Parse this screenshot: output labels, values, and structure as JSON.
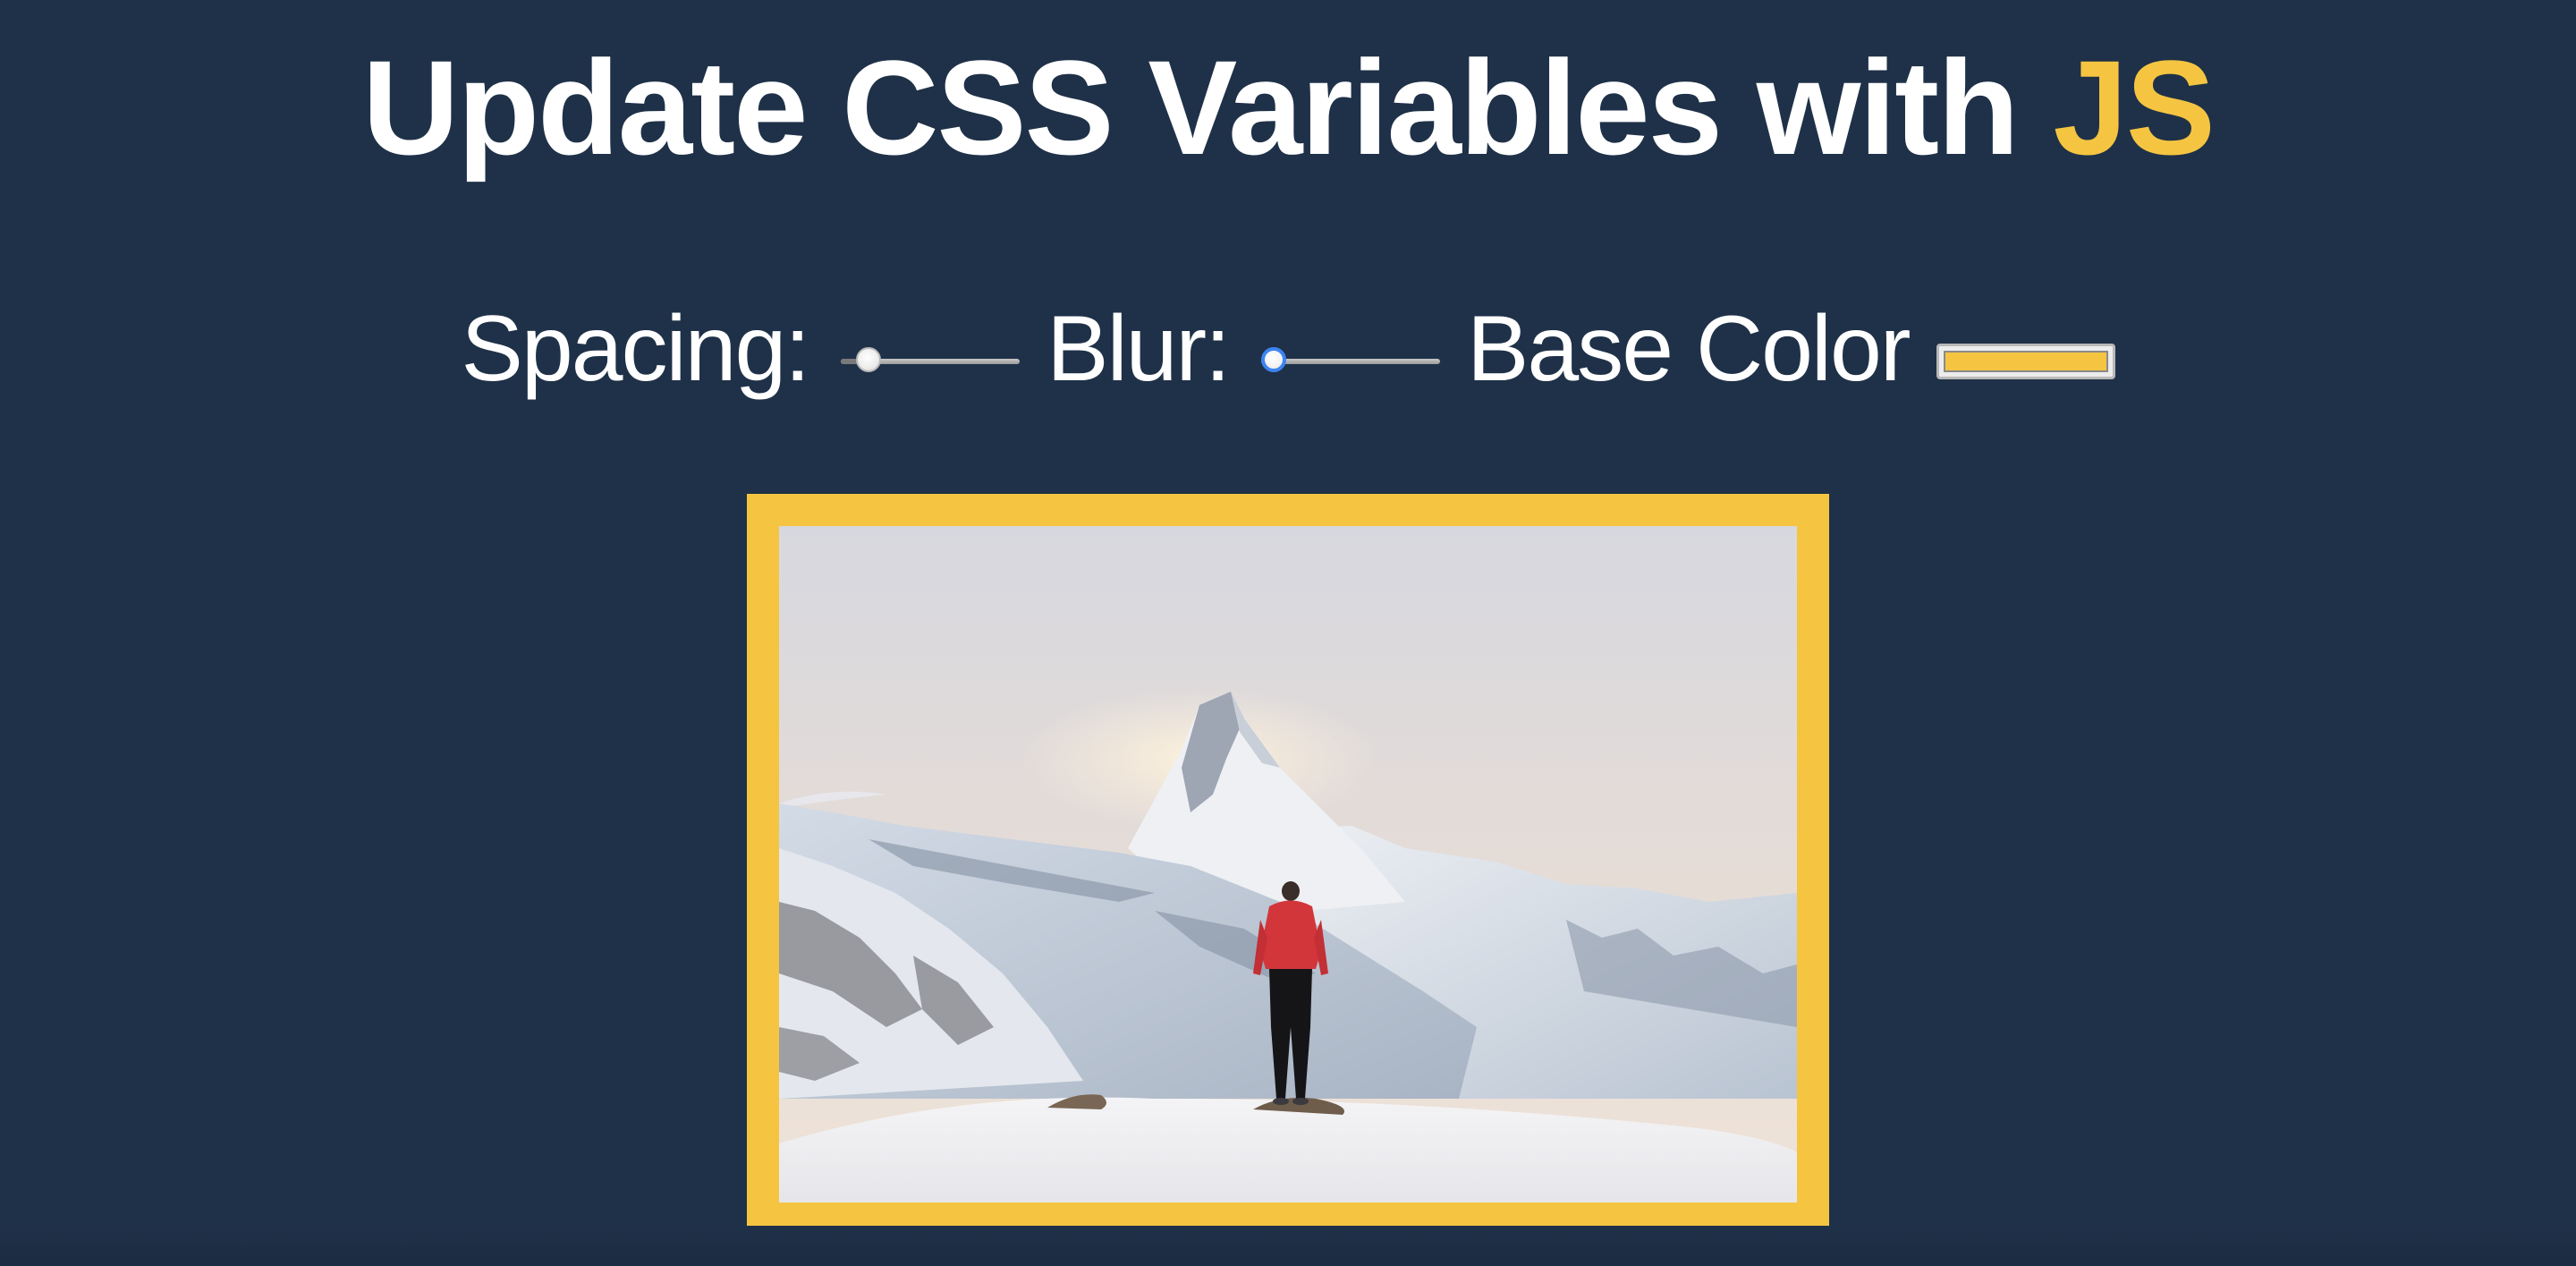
{
  "header": {
    "title_main": "Update CSS Variables with ",
    "title_highlight": "JS"
  },
  "controls": {
    "spacing_label": "Spacing:",
    "spacing_value": 0.1,
    "blur_label": "Blur:",
    "blur_value": 0.0,
    "base_color_label": "Base Color"
  },
  "colors": {
    "background": "#1f3148",
    "accent": "#f5c542",
    "text": "#ffffff"
  },
  "image": {
    "icon": "mountain-photo-icon",
    "subject": "hiker-red-jacket"
  }
}
